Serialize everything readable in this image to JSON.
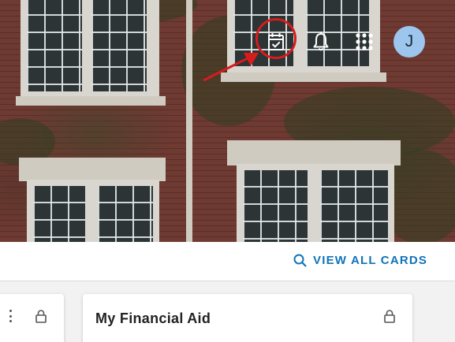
{
  "header": {
    "icons": [
      "calendar-check-icon",
      "bell-icon",
      "apps-grid-icon"
    ],
    "avatar_initial": "J",
    "highlight_color": "#d71c1c"
  },
  "cards_bar": {
    "view_all_label": "VIEW ALL CARDS",
    "link_color": "#1273b8"
  },
  "cards": [
    {
      "title": "",
      "icons": [
        "more-vertical-icon",
        "lock-icon"
      ]
    },
    {
      "title": "My Financial Aid",
      "icons": [
        "lock-icon"
      ]
    }
  ]
}
